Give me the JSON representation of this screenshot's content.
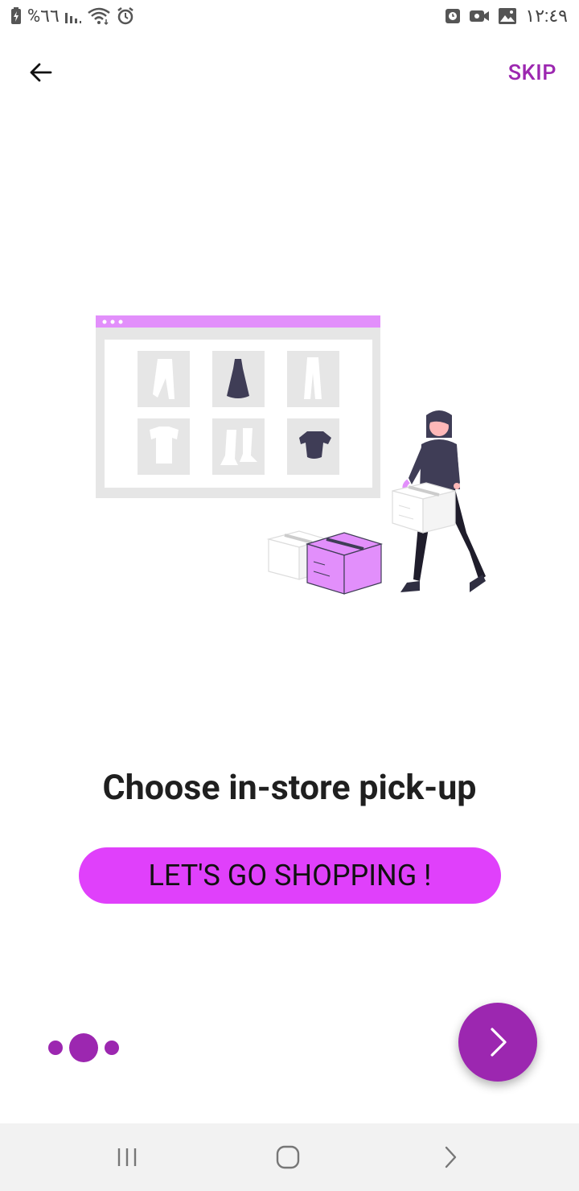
{
  "status_bar": {
    "battery_text": "%٦٦",
    "time": "١٢:٤٩"
  },
  "header": {
    "back_icon": "arrow-left-icon",
    "skip_label": "SKIP"
  },
  "onboarding": {
    "title": "Choose in-store pick-up",
    "cta_label": "LET'S GO SHOPPING !",
    "page_indicator": {
      "pages": 3,
      "current": 2
    },
    "next_icon": "chevron-right-icon"
  },
  "nav_bar": {
    "recents_icon": "recents-icon",
    "home_icon": "home-icon",
    "back_icon": "chevron-right-icon"
  },
  "colors": {
    "accent": "#9c27b0",
    "cta": "#e040fb",
    "illustration_purple": "#e28ffb",
    "dark_figure": "#3f3d56",
    "panel_gray": "#e6e6e6",
    "nav_bg": "#f2f2f2"
  }
}
